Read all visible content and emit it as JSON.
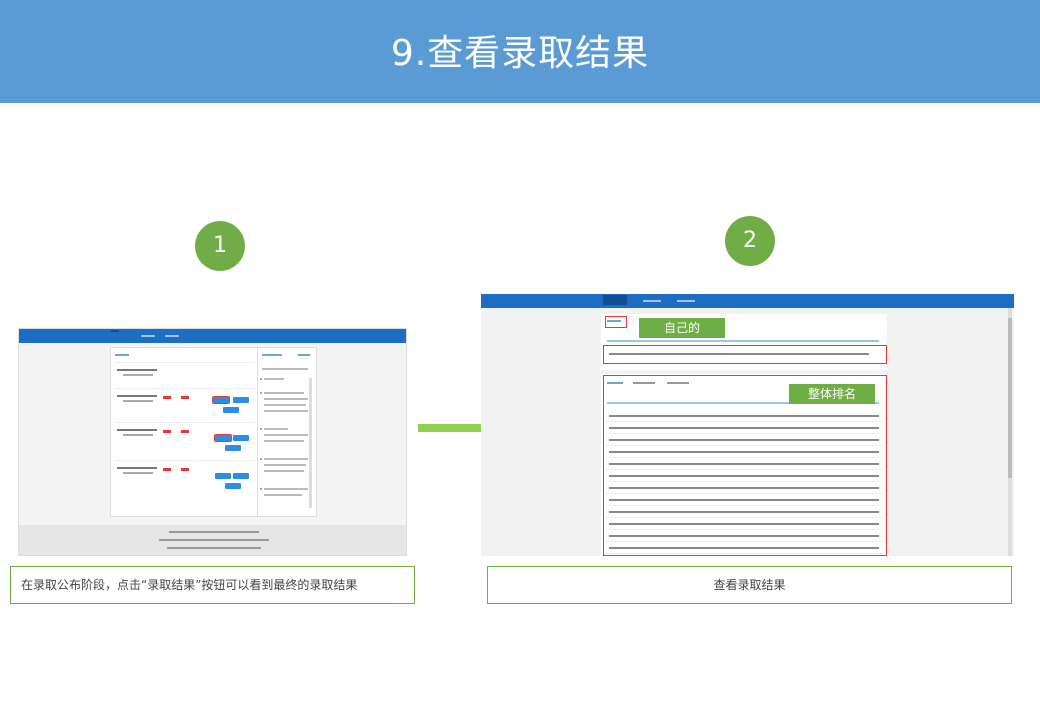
{
  "header": {
    "title": "9.查看录取结果"
  },
  "steps": [
    {
      "number": "1",
      "caption": "在录取公布阶段，点击“录取结果”按钮可以看到最终的录取结果"
    },
    {
      "number": "2",
      "caption": "查看录取结果"
    }
  ],
  "screenshot2": {
    "label_self": "自己的",
    "label_ranking": "整体排名"
  },
  "colors": {
    "banner": "#5b9bd5",
    "accent_green": "#70ad47",
    "highlight_red": "#e53935",
    "nav_blue": "#1b6ec2"
  }
}
